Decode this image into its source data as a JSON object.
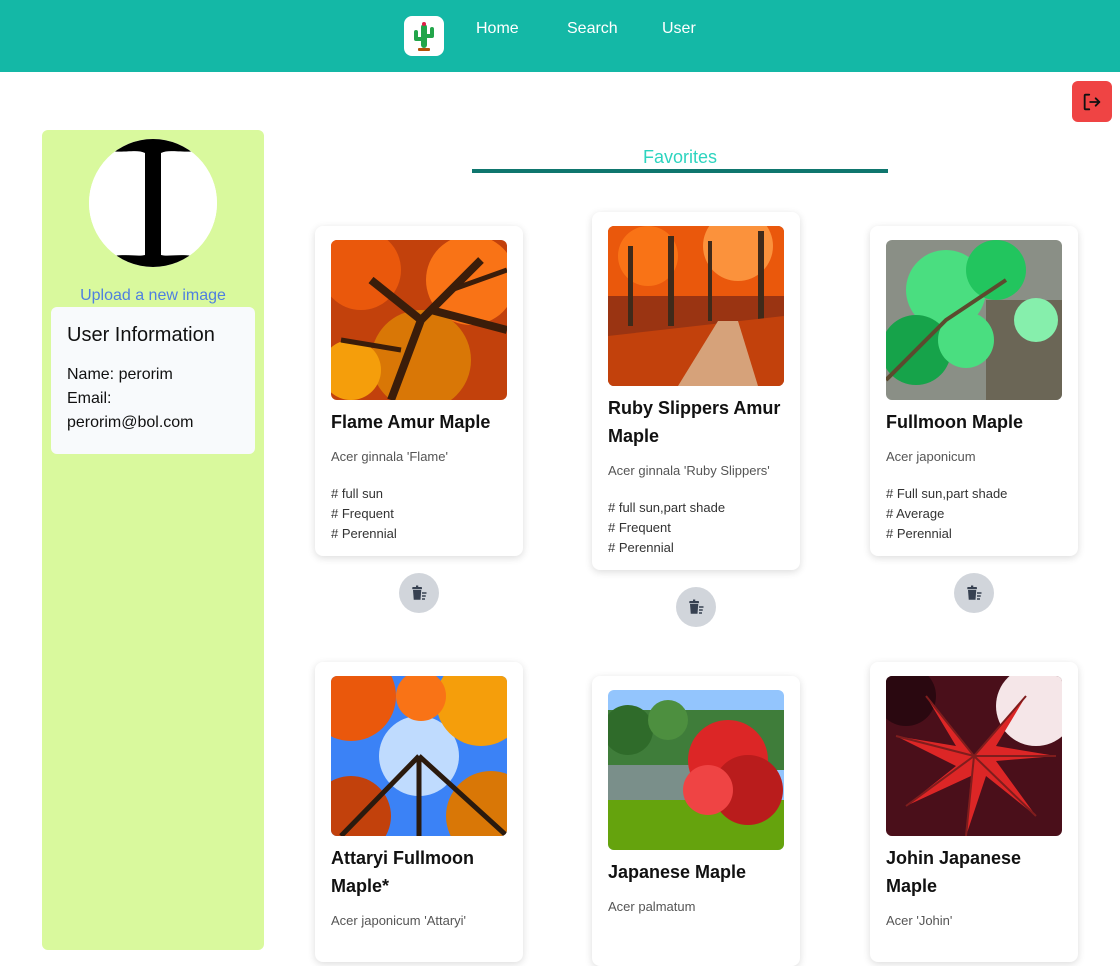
{
  "nav": {
    "links": [
      "Home",
      "Search",
      "User"
    ]
  },
  "sidebar": {
    "upload_label": "Upload a new image",
    "user_info": {
      "title": "User Information",
      "name_line": "Name: perorim",
      "email_label": "Email:",
      "email_value": "perorim@bol.com"
    }
  },
  "favorites": {
    "title": "Favorites",
    "cards": [
      {
        "name": "Flame Amur Maple",
        "scientific": "Acer ginnala 'Flame'",
        "tags": [
          "# full sun",
          "# Frequent",
          "# Perennial"
        ]
      },
      {
        "name": "Ruby Slippers Amur Maple",
        "scientific": "Acer ginnala 'Ruby Slippers'",
        "tags": [
          "# full sun,part shade",
          "# Frequent",
          "# Perennial"
        ]
      },
      {
        "name": "Fullmoon Maple",
        "scientific": "Acer japonicum",
        "tags": [
          "# Full sun,part shade",
          "# Average",
          "# Perennial"
        ]
      },
      {
        "name": "Attaryi Fullmoon Maple*",
        "scientific": "Acer japonicum 'Attaryi'",
        "tags": []
      },
      {
        "name": "Japanese Maple",
        "scientific": "Acer palmatum",
        "tags": []
      },
      {
        "name": "Johin Japanese Maple",
        "scientific": "Acer 'Johin'",
        "tags": []
      }
    ]
  },
  "colors": {
    "navbar": "#14b8a6",
    "sidebar": "#d9f99d",
    "logout": "#ef4444",
    "accent_dark": "#0f766e",
    "accent_light": "#2dd4bf"
  },
  "icons": {
    "logo": "cactus-logo-icon",
    "logout": "logout-icon",
    "delete": "trash-icon"
  }
}
